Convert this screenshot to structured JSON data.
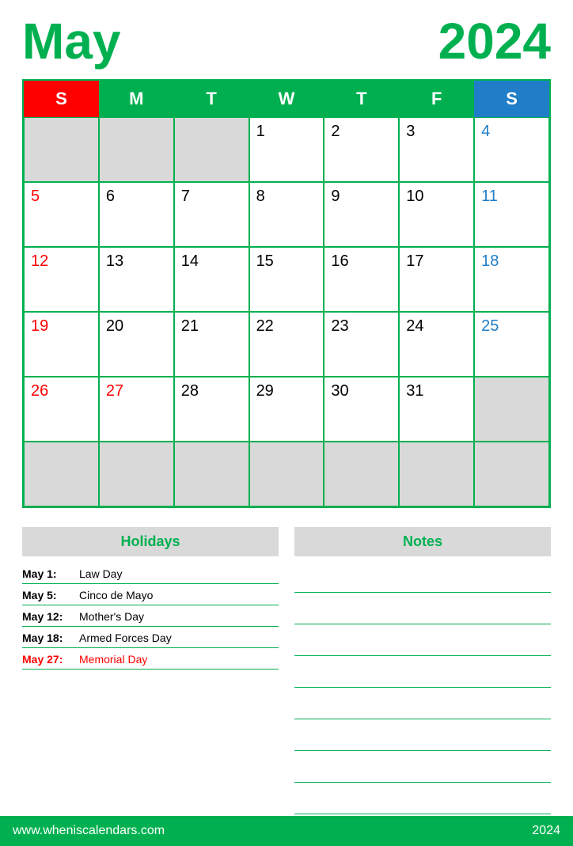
{
  "header": {
    "month": "May",
    "year": "2024"
  },
  "calendar": {
    "day_headers": [
      {
        "label": "S",
        "type": "sunday"
      },
      {
        "label": "M",
        "type": "weekday"
      },
      {
        "label": "T",
        "type": "weekday"
      },
      {
        "label": "W",
        "type": "weekday"
      },
      {
        "label": "T",
        "type": "weekday"
      },
      {
        "label": "F",
        "type": "weekday"
      },
      {
        "label": "S",
        "type": "saturday"
      }
    ],
    "rows": [
      [
        {
          "day": "",
          "type": "empty"
        },
        {
          "day": "",
          "type": "empty"
        },
        {
          "day": "",
          "type": "empty"
        },
        {
          "day": "1",
          "type": "normal"
        },
        {
          "day": "2",
          "type": "normal"
        },
        {
          "day": "3",
          "type": "normal"
        },
        {
          "day": "4",
          "type": "saturday"
        }
      ],
      [
        {
          "day": "5",
          "type": "sunday"
        },
        {
          "day": "6",
          "type": "normal"
        },
        {
          "day": "7",
          "type": "normal"
        },
        {
          "day": "8",
          "type": "normal"
        },
        {
          "day": "9",
          "type": "normal"
        },
        {
          "day": "10",
          "type": "normal"
        },
        {
          "day": "11",
          "type": "saturday"
        }
      ],
      [
        {
          "day": "12",
          "type": "sunday"
        },
        {
          "day": "13",
          "type": "normal"
        },
        {
          "day": "14",
          "type": "normal"
        },
        {
          "day": "15",
          "type": "normal"
        },
        {
          "day": "16",
          "type": "normal"
        },
        {
          "day": "17",
          "type": "normal"
        },
        {
          "day": "18",
          "type": "saturday"
        }
      ],
      [
        {
          "day": "19",
          "type": "sunday"
        },
        {
          "day": "20",
          "type": "normal"
        },
        {
          "day": "21",
          "type": "normal"
        },
        {
          "day": "22",
          "type": "normal"
        },
        {
          "day": "23",
          "type": "normal"
        },
        {
          "day": "24",
          "type": "normal"
        },
        {
          "day": "25",
          "type": "saturday"
        }
      ],
      [
        {
          "day": "26",
          "type": "sunday"
        },
        {
          "day": "27",
          "type": "holiday"
        },
        {
          "day": "28",
          "type": "normal"
        },
        {
          "day": "29",
          "type": "normal"
        },
        {
          "day": "30",
          "type": "normal"
        },
        {
          "day": "31",
          "type": "normal"
        },
        {
          "day": "",
          "type": "empty"
        }
      ],
      [
        {
          "day": "",
          "type": "empty"
        },
        {
          "day": "",
          "type": "empty"
        },
        {
          "day": "",
          "type": "empty"
        },
        {
          "day": "",
          "type": "empty"
        },
        {
          "day": "",
          "type": "empty"
        },
        {
          "day": "",
          "type": "empty"
        },
        {
          "day": "",
          "type": "empty"
        }
      ]
    ]
  },
  "holidays": {
    "header": "Holidays",
    "items": [
      {
        "date": "May 1:",
        "name": "Law Day",
        "red": false
      },
      {
        "date": "May 5:",
        "name": "Cinco de Mayo",
        "red": false
      },
      {
        "date": "May 12:",
        "name": "Mother's Day",
        "red": false
      },
      {
        "date": "May 18:",
        "name": "Armed Forces Day",
        "red": false
      },
      {
        "date": "May 27:",
        "name": "Memorial Day",
        "red": true
      }
    ]
  },
  "notes": {
    "header": "Notes",
    "line_count": 8
  },
  "footer": {
    "url": "www.wheniscalendars.com",
    "year": "2024"
  }
}
